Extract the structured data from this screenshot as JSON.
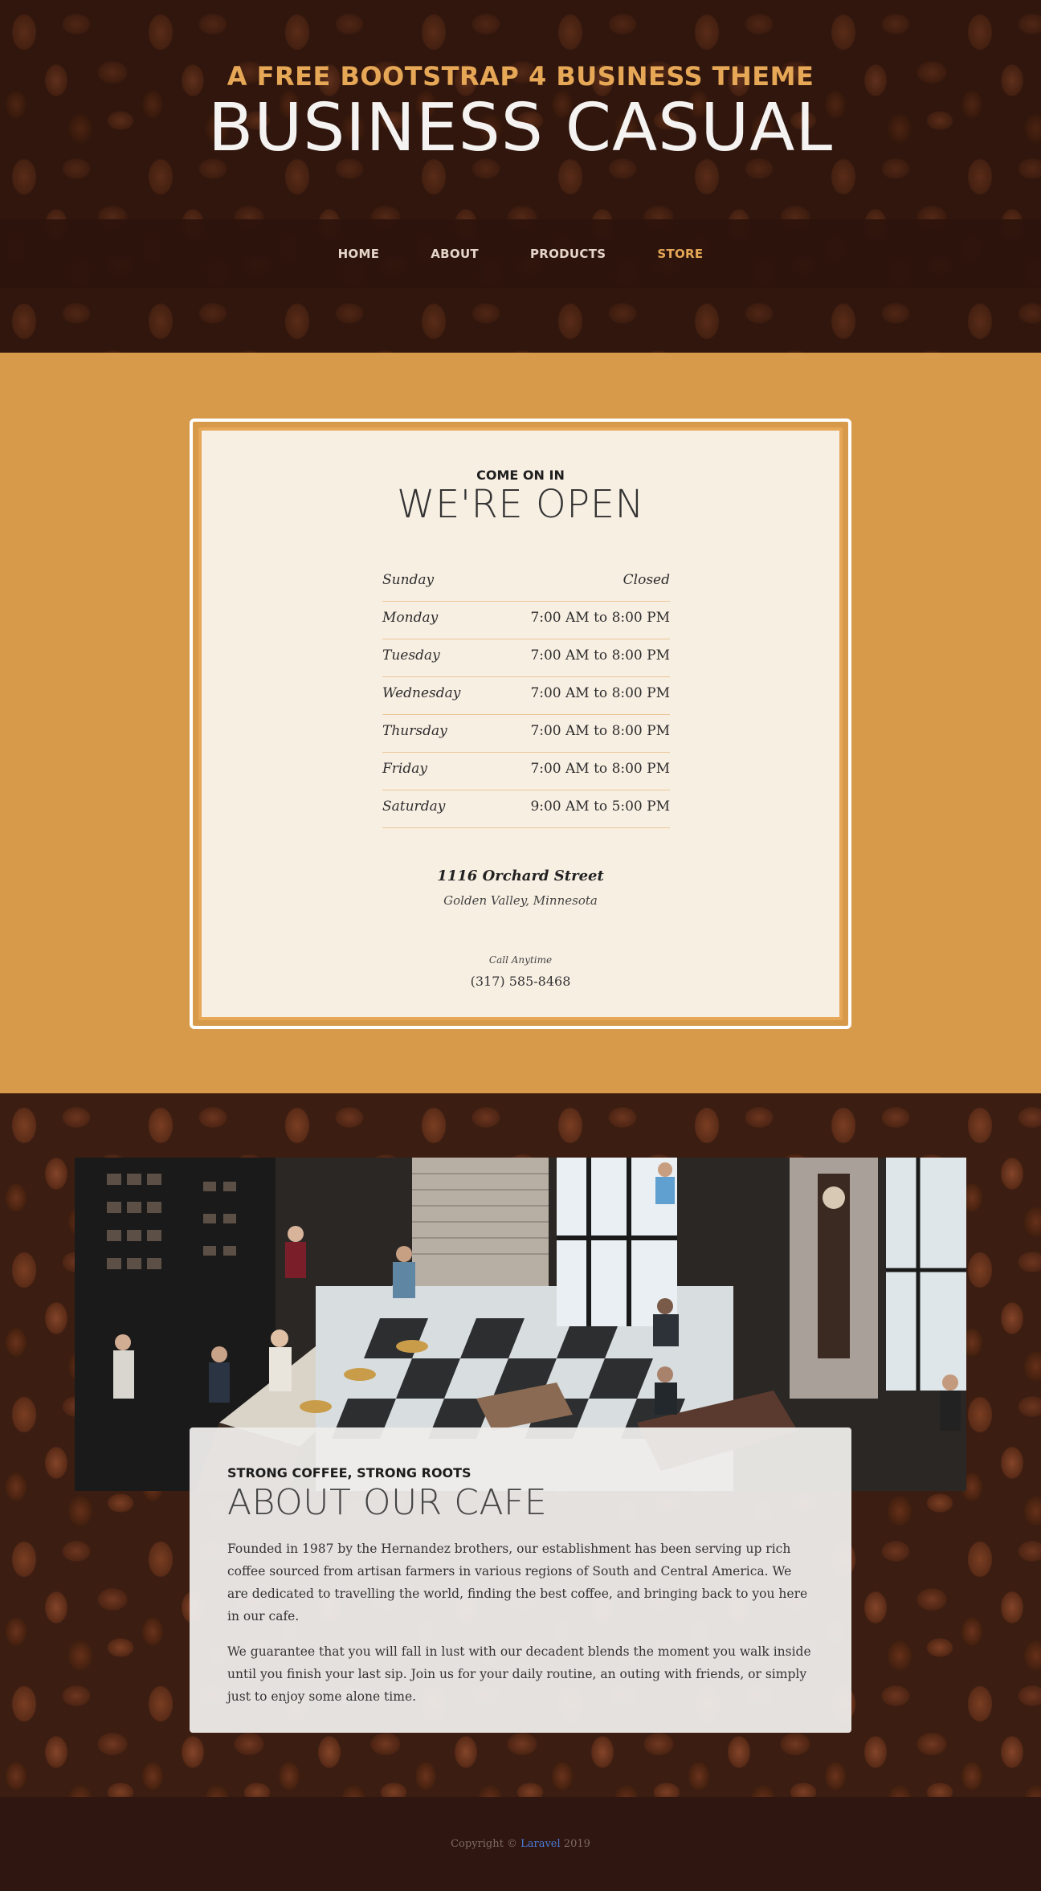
{
  "header": {
    "subtitle": "A FREE BOOTSTRAP 4 BUSINESS THEME",
    "title": "BUSINESS CASUAL"
  },
  "nav": {
    "items": [
      {
        "label": "HOME",
        "active": false
      },
      {
        "label": "ABOUT",
        "active": false
      },
      {
        "label": "PRODUCTS",
        "active": false
      },
      {
        "label": "STORE",
        "active": true
      }
    ]
  },
  "hours": {
    "kicker": "COME ON IN",
    "title": "WE'RE OPEN",
    "rows": [
      {
        "day": "Sunday",
        "time": "Closed"
      },
      {
        "day": "Monday",
        "time": "7:00 AM to 8:00 PM"
      },
      {
        "day": "Tuesday",
        "time": "7:00 AM to 8:00 PM"
      },
      {
        "day": "Wednesday",
        "time": "7:00 AM to 8:00 PM"
      },
      {
        "day": "Thursday",
        "time": "7:00 AM to 8:00 PM"
      },
      {
        "day": "Friday",
        "time": "7:00 AM to 8:00 PM"
      },
      {
        "day": "Saturday",
        "time": "9:00 AM to 5:00 PM"
      }
    ],
    "address": "1116 Orchard Street",
    "city": "Golden Valley, Minnesota",
    "call_label": "Call Anytime",
    "phone": "(317) 585-8468"
  },
  "about": {
    "kicker": "STRONG COFFEE, STRONG ROOTS",
    "title": "ABOUT OUR CAFE",
    "paragraphs": [
      "Founded in 1987 by the Hernandez brothers, our establishment has been serving up rich coffee sourced from artisan farmers in various regions of South and Central America. We are dedicated to travelling the world, finding the best coffee, and bringing back to you here in our cafe.",
      "We guarantee that you will fall in lust with our decadent blends the moment you walk inside until you finish your last sip. Join us for your daily routine, an outing with friends, or simply just to enjoy some alone time."
    ]
  },
  "footer": {
    "prefix": "Copyright ©",
    "link": "Laravel",
    "year": "2019"
  },
  "colors": {
    "accent": "#e6a756",
    "hours_bg": "#d69a4a",
    "card_bg": "#f8efe3",
    "nav_bg": "#2c140c",
    "footer_link": "#4a7bd8"
  }
}
